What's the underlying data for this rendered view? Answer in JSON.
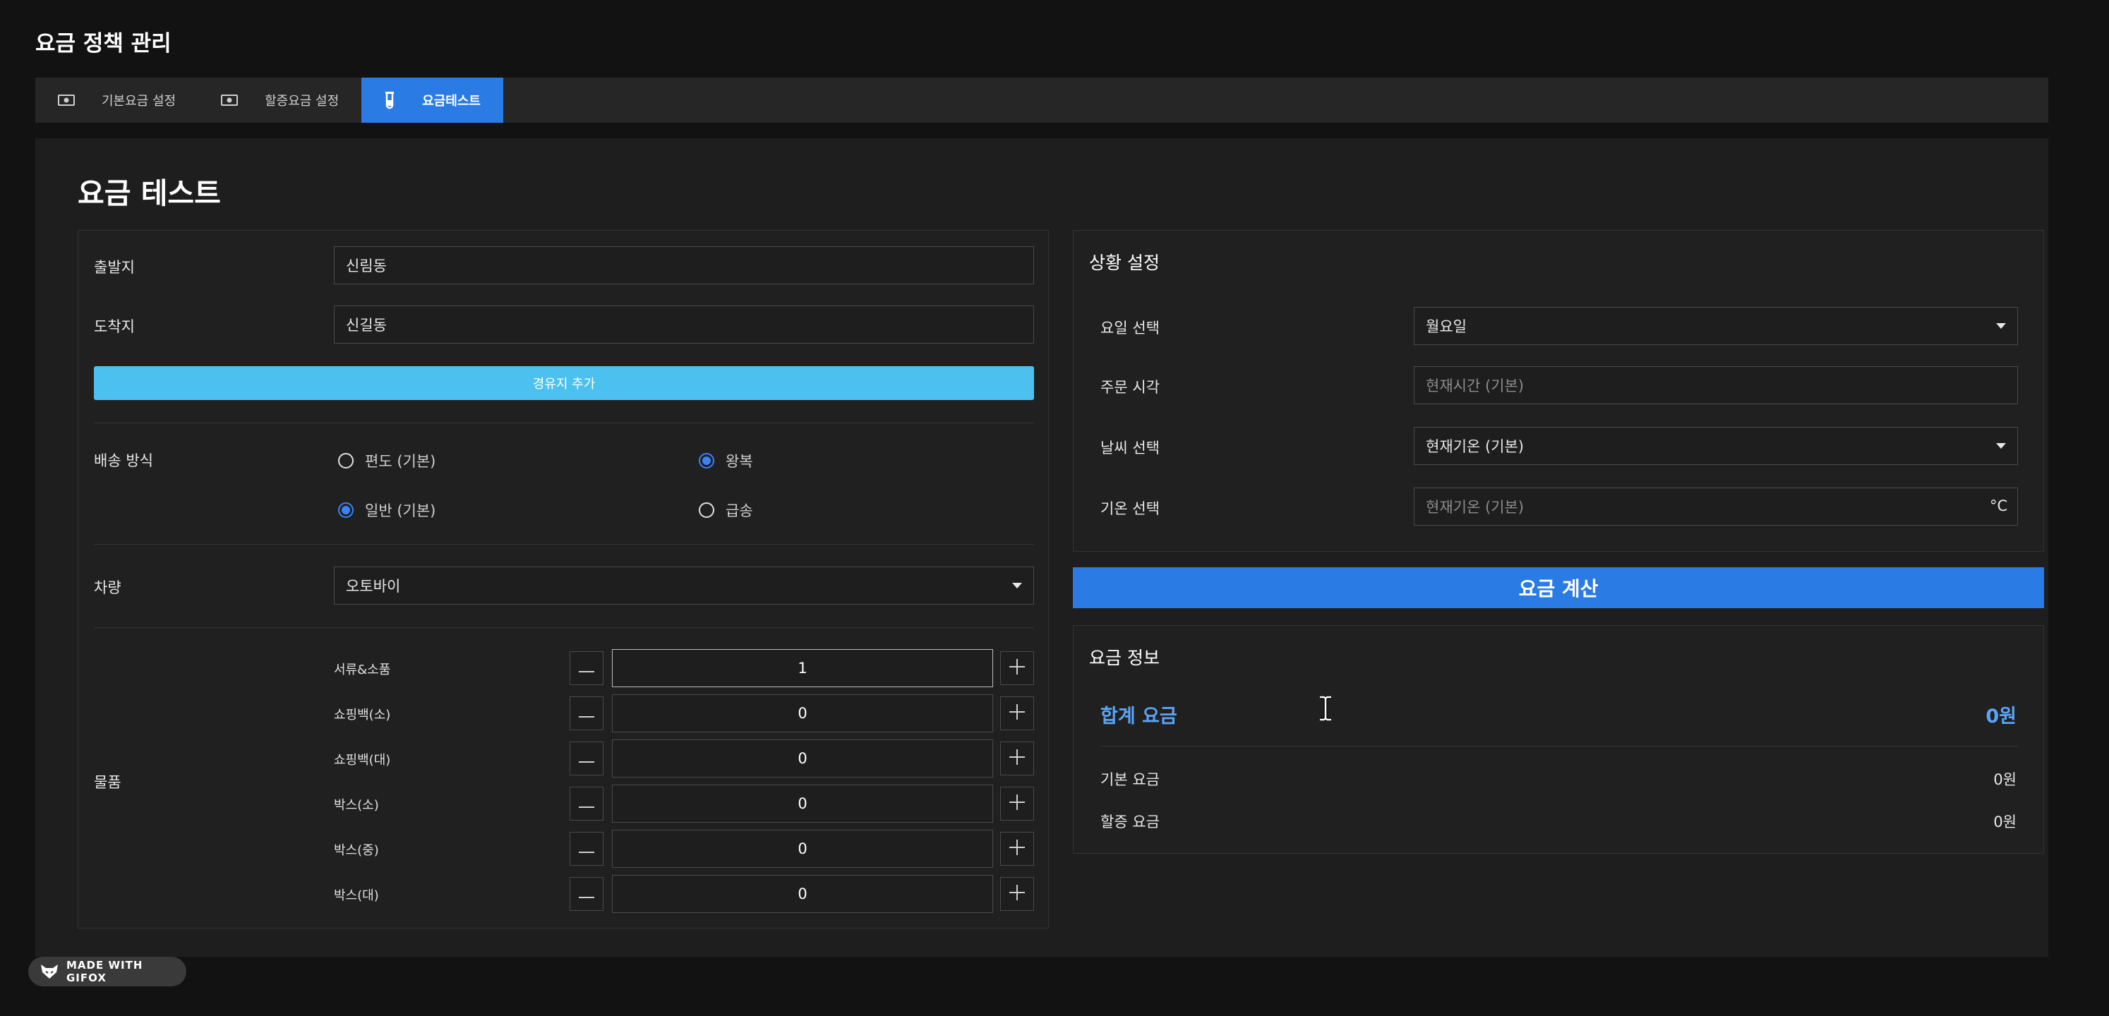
{
  "app": {
    "title": "요금 정책 관리"
  },
  "tabs": [
    {
      "label": "기본요금 설정",
      "icon": "money-icon"
    },
    {
      "label": "할증요금 설정",
      "icon": "money-icon"
    },
    {
      "label": "요금테스트",
      "icon": "test-tube-icon",
      "active": true
    }
  ],
  "section": {
    "title": "요금 테스트"
  },
  "route": {
    "origin_label": "출발지",
    "origin_value": "신림동",
    "destination_label": "도착지",
    "destination_value": "신길동",
    "waypoint_button": "경유지 추가"
  },
  "delivery": {
    "label": "배송 방식",
    "options": [
      {
        "label": "편도 (기본)",
        "checked": false
      },
      {
        "label": "왕복",
        "checked": true
      },
      {
        "label": "일반 (기본)",
        "checked": true
      },
      {
        "label": "급송",
        "checked": false
      }
    ]
  },
  "vehicle": {
    "label": "차량",
    "value": "오토바이"
  },
  "items": {
    "label": "물품",
    "list": [
      {
        "name": "서류&소품",
        "qty": "1"
      },
      {
        "name": "쇼핑백(소)",
        "qty": "0"
      },
      {
        "name": "쇼핑백(대)",
        "qty": "0"
      },
      {
        "name": "박스(소)",
        "qty": "0"
      },
      {
        "name": "박스(중)",
        "qty": "0"
      },
      {
        "name": "박스(대)",
        "qty": "0"
      }
    ]
  },
  "situation": {
    "title": "상황 설정",
    "day_label": "요일 선택",
    "day_value": "월요일",
    "time_label": "주문 시각",
    "time_placeholder": "현재시간 (기본)",
    "weather_label": "날씨 선택",
    "weather_value": "현재기온 (기본)",
    "temp_label": "기온 선택",
    "temp_placeholder": "현재기온 (기본)",
    "temp_unit": "°C"
  },
  "calc_button": "요금 계산",
  "fee_info": {
    "title": "요금 정보",
    "total_label": "합계 요금",
    "total_value": "0원",
    "base_label": "기본 요금",
    "base_value": "0원",
    "surcharge_label": "할증 요금",
    "surcharge_value": "0원"
  },
  "watermark": {
    "text": "MADE WITH GIFOX"
  },
  "colors": {
    "accent": "#2b7be4",
    "waypoint": "#4cc1ef",
    "total": "#5ba4f5"
  }
}
